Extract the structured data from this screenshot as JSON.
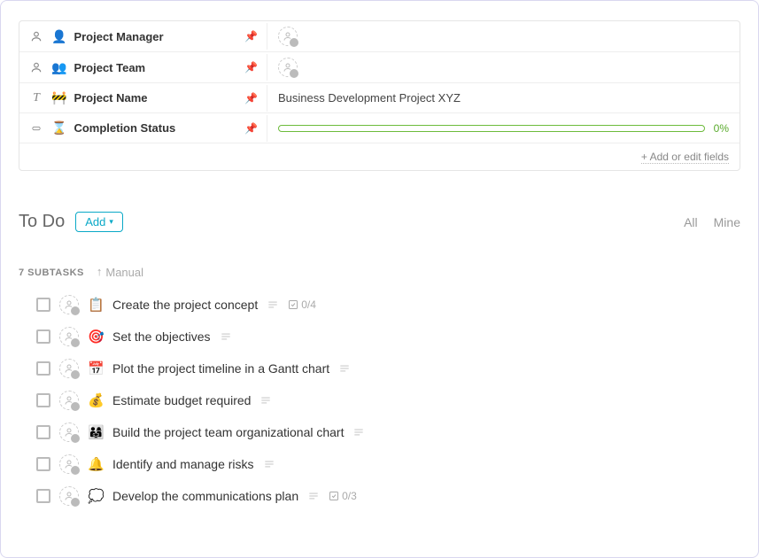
{
  "fields": {
    "project_manager": {
      "label": "Project Manager",
      "emoji": "👤",
      "value": ""
    },
    "project_team": {
      "label": "Project Team",
      "emoji": "👥",
      "value": ""
    },
    "project_name": {
      "label": "Project Name",
      "emoji": "🚧",
      "value": "Business Development Project XYZ"
    },
    "completion": {
      "label": "Completion Status",
      "emoji": "⌛",
      "value_pct": "0%"
    }
  },
  "add_edit_fields_label": "+ Add or edit fields",
  "todo": {
    "title": "To Do",
    "add_button_label": "Add",
    "filters": {
      "all": "All",
      "mine": "Mine"
    },
    "subtasks_count_label": "7 SUBTASKS",
    "sort_label": "Manual"
  },
  "tasks": [
    {
      "emoji": "📋",
      "title": "Create the project concept",
      "checklist": "0/4"
    },
    {
      "emoji": "🎯",
      "title": "Set the objectives"
    },
    {
      "emoji": "📅",
      "title": "Plot the project timeline in a Gantt chart"
    },
    {
      "emoji": "💰",
      "title": "Estimate budget required"
    },
    {
      "emoji": "👨‍👩‍👧",
      "title": "Build the project team organizational chart"
    },
    {
      "emoji": "🔔",
      "title": "Identify and manage risks"
    },
    {
      "emoji": "💭",
      "title": "Develop the communications plan",
      "checklist": "0/3"
    }
  ]
}
